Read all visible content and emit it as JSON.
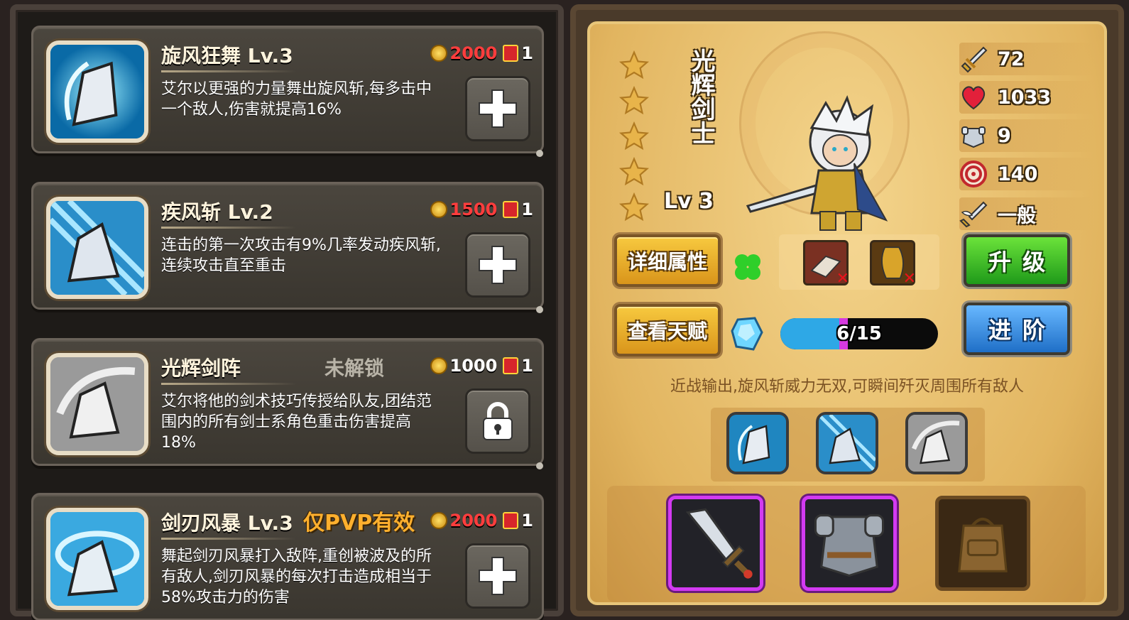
{
  "skills": [
    {
      "name": "旋风狂舞 Lv.3",
      "description": "艾尔以更强的力量舞出旋风斩,每多击中一个敌人,伤害就提高16%",
      "cost_gold": "2000",
      "cost_book": "1",
      "tag": "",
      "action_icon": "plus-icon",
      "locked": false
    },
    {
      "name": "疾风斩 Lv.2",
      "description": "连击的第一次攻击有9%几率发动疾风斩,连续攻击直至重击",
      "cost_gold": "1500",
      "cost_book": "1",
      "tag": "",
      "action_icon": "plus-icon",
      "locked": false
    },
    {
      "name": "光辉剑阵",
      "description": "艾尔将他的剑术技巧传授给队友,团结范围内的所有剑士系角色重击伤害提高18%",
      "cost_gold": "1000",
      "cost_book": "1",
      "tag": "未解锁",
      "action_icon": "lock-icon",
      "locked": true
    },
    {
      "name": "剑刃风暴 Lv.3",
      "description": "舞起剑刃风暴打入敌阵,重创被波及的所有敌人,剑刃风暴的每次打击造成相当于58%攻击力的伤害",
      "cost_gold": "2000",
      "cost_book": "1",
      "tag": "仅PVP有效",
      "action_icon": "plus-icon",
      "locked": false
    }
  ],
  "hero": {
    "name": "光辉剑士",
    "level": "Lv 3",
    "stars": 5,
    "stats": {
      "attack": "72",
      "health": "1033",
      "armor": "9",
      "accuracy": "140",
      "attack_speed": "一般"
    },
    "buttons": {
      "details": "详细属性",
      "talent": "查看天赋",
      "upgrade": "升级",
      "advance": "进阶"
    },
    "talent_progress": {
      "text": "6/15",
      "current": 6,
      "max": 15
    },
    "description": "近战输出,旋风斩威力无双,可瞬间歼灭周围所有敌人"
  },
  "colors": {
    "cost_red": "#ff3d3d",
    "tag_gold": "#ffb02e",
    "tag_gray": "#b9b4a8",
    "progress_blue": "#2ea8e6",
    "progress_marker": "#d63adf",
    "equip_purple": "#d33af2"
  }
}
